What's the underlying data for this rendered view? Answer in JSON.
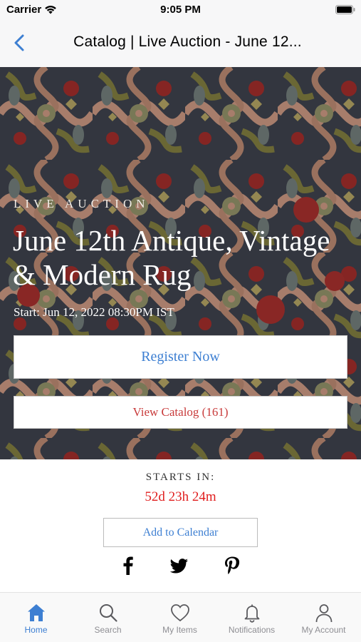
{
  "status_bar": {
    "carrier": "Carrier",
    "time": "9:05 PM"
  },
  "nav": {
    "title": "Catalog | Live Auction - June 12..."
  },
  "hero": {
    "eyebrow": "LIVE AUCTION",
    "title": "June 12th Antique, Vintage & Modern Rug",
    "start": "Start: Jun 12, 2022 08:30PM IST",
    "register_label": "Register Now",
    "catalog_label": "View Catalog (161)"
  },
  "countdown": {
    "label": "STARTS IN:",
    "value": "52d 23h 24m",
    "calendar_label": "Add to Calendar"
  },
  "tabs": [
    {
      "label": "Home",
      "icon": "home-icon",
      "active": true
    },
    {
      "label": "Search",
      "icon": "search-icon"
    },
    {
      "label": "My Items",
      "icon": "heart-icon"
    },
    {
      "label": "Notifications",
      "icon": "bell-icon"
    },
    {
      "label": "My Account",
      "icon": "person-icon"
    }
  ],
  "colors": {
    "accent": "#3d7fd2",
    "countdown": "#e01e1e",
    "catalog": "#c83b3b"
  }
}
